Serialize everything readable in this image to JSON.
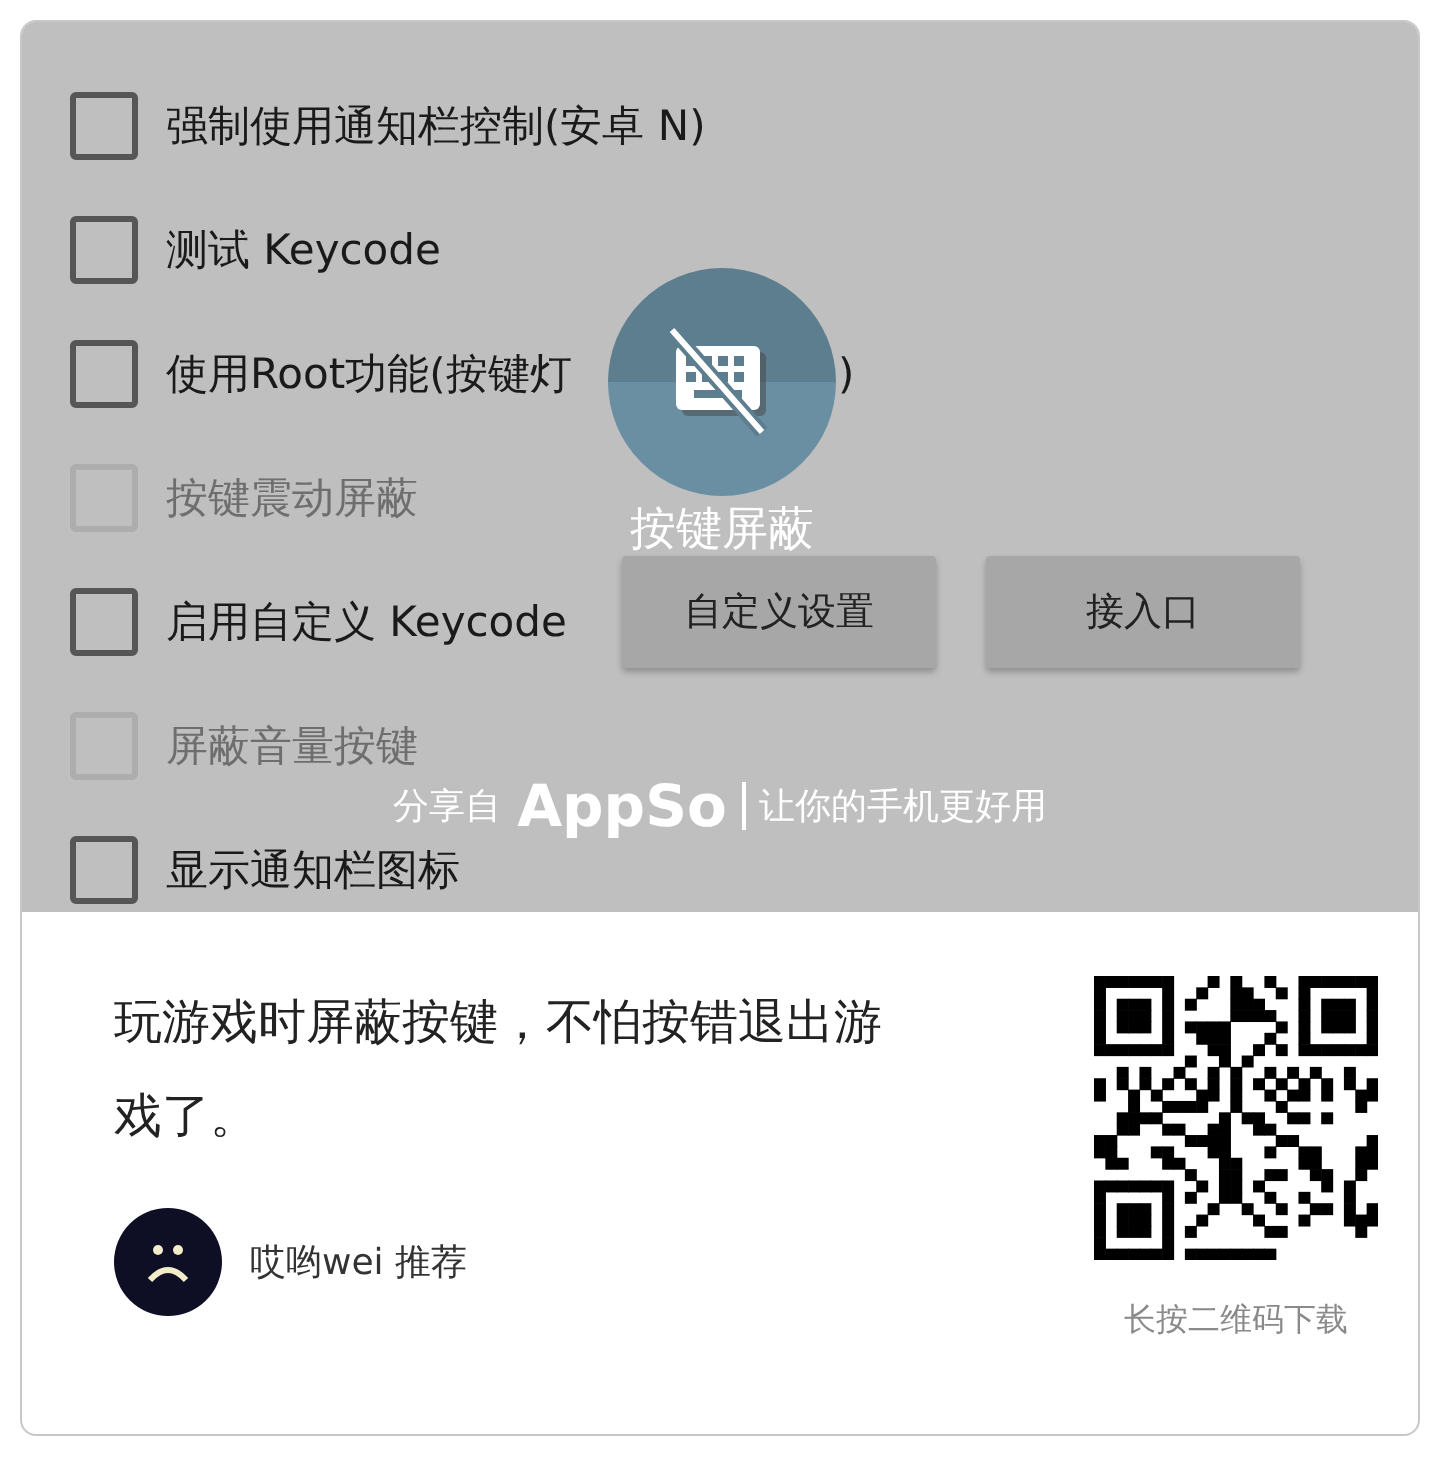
{
  "app_screen": {
    "options": [
      {
        "label": "强制使用通知栏控制(安卓 N)",
        "checked": false,
        "disabled": false
      },
      {
        "label": "测试 Keycode",
        "checked": false,
        "disabled": false
      },
      {
        "label": "使用Root功能(按键灯",
        "label_tail": ")",
        "checked": false,
        "disabled": false
      },
      {
        "label": "按键震动屏蔽",
        "checked": false,
        "disabled": true
      },
      {
        "label": "启用自定义 Keycode",
        "checked": false,
        "disabled": false
      },
      {
        "label": "屏蔽音量按键",
        "checked": false,
        "disabled": true
      },
      {
        "label": "显示通知栏图标",
        "checked": false,
        "disabled": false
      }
    ],
    "buttons": [
      "自定义设置",
      "接入口"
    ]
  },
  "overlay": {
    "app_name": "按键屏蔽",
    "share_prefix": "分享自",
    "brand": "AppSo",
    "slogan": "让你的手机更好用"
  },
  "share_card": {
    "description": "玩游戏时屏蔽按键，不怕按错退出游戏了。",
    "recommender": "哎哟wei 推荐",
    "qr_caption": "长按二维码下载"
  }
}
